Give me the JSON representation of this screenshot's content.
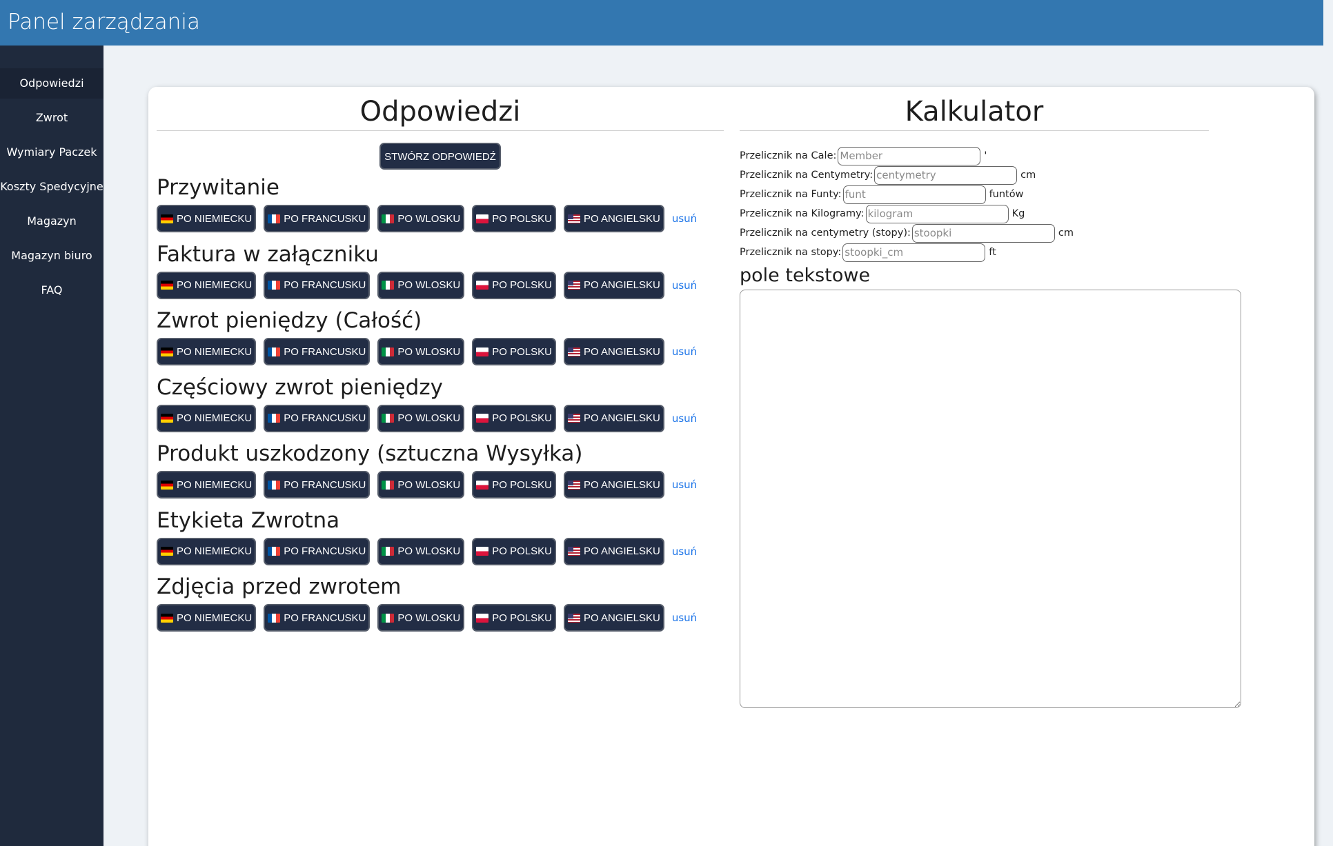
{
  "header": {
    "title": "Panel zarządzania"
  },
  "sidebar": {
    "items": [
      {
        "label": "Odpowiedzi",
        "active": true
      },
      {
        "label": "Zwrot"
      },
      {
        "label": "Wymiary Paczek"
      },
      {
        "label": "Koszty Spedycyjne"
      },
      {
        "label": "Magazyn"
      },
      {
        "label": "Magazyn biuro"
      },
      {
        "label": "FAQ"
      }
    ]
  },
  "answers": {
    "title": "Odpowiedzi",
    "create_label": "STWÓRZ ODPOWIEDŹ",
    "remove_label": "usuń",
    "languages": [
      {
        "label": "PO NIEMIECKU",
        "flag": "flag-de-icon"
      },
      {
        "label": "PO FRANCUSKU",
        "flag": "flag-fr-icon"
      },
      {
        "label": "PO WLOSKU",
        "flag": "flag-it-icon"
      },
      {
        "label": "PO POLSKU",
        "flag": "flag-pl-icon"
      },
      {
        "label": "PO ANGIELSKU",
        "flag": "flag-us-icon"
      }
    ],
    "groups": [
      {
        "title": "Przywitanie"
      },
      {
        "title": "Faktura w załączniku"
      },
      {
        "title": "Zwrot pieniędzy (Całość)"
      },
      {
        "title": "Częściowy zwrot pieniędzy"
      },
      {
        "title": "Produkt uszkodzony (sztuczna Wysyłka)"
      },
      {
        "title": "Etykieta Zwrotna"
      },
      {
        "title": "Zdjęcia przed zwrotem"
      }
    ]
  },
  "calculator": {
    "title": "Kalkulator",
    "rows": [
      {
        "label": "Przelicznik na Cale:",
        "placeholder": "Member",
        "unit": "'"
      },
      {
        "label": "Przelicznik na Centymetry:",
        "placeholder": "centymetry",
        "unit": "cm"
      },
      {
        "label": "Przelicznik na Funty:",
        "placeholder": "funt",
        "unit": "funtów"
      },
      {
        "label": "Przelicznik na Kilogramy:",
        "placeholder": "kilogram",
        "unit": "Kg"
      },
      {
        "label": "Przelicznik na centymetry (stopy):",
        "placeholder": "stoopki",
        "unit": "cm"
      },
      {
        "label": "Przelicznik na stopy:",
        "placeholder": "stoopki_cm",
        "unit": "ft"
      }
    ],
    "textarea_label": "pole tekstowe"
  }
}
